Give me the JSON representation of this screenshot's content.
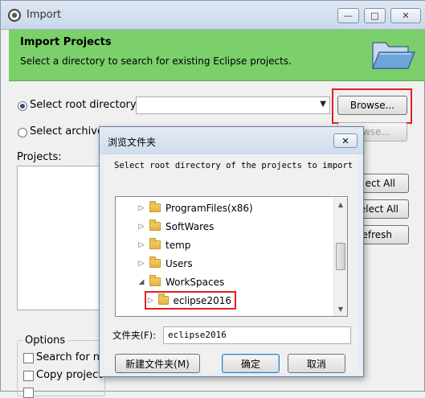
{
  "main_window": {
    "title": "Import",
    "caption_buttons": {
      "minimize": "—",
      "maximize": "□",
      "close": "✕"
    },
    "header": {
      "title": "Import Projects",
      "subtitle": "Select a directory to search for existing Eclipse projects.",
      "icon": "folder-open-icon"
    },
    "root_directory": {
      "label": "Select root directory:",
      "value": "",
      "browse_label": "Browse...",
      "selected": true
    },
    "archive_file": {
      "label": "Select archive",
      "browse_label": "Browse...",
      "selected": false
    },
    "projects_label": "Projects:",
    "side_buttons": {
      "select_all": "ect All",
      "deselect_all": "elect All",
      "refresh": "efresh"
    },
    "options": {
      "label": "Options",
      "search_nested": "Search for ne",
      "copy_projects": "Copy project"
    }
  },
  "dialog": {
    "title": "浏览文件夹",
    "close_label": "✕",
    "instruction": "Select root directory of the projects to import",
    "tree_items": [
      {
        "label": "ProgramFiles(x86)",
        "expander": "▷"
      },
      {
        "label": "SoftWares",
        "expander": "▷"
      },
      {
        "label": "temp",
        "expander": "▷"
      },
      {
        "label": "Users",
        "expander": "▷"
      },
      {
        "label": "WorkSpaces",
        "expander": "◢"
      },
      {
        "label": "eclipse2016",
        "expander": "▷",
        "selected": true
      }
    ],
    "folder_label": "文件夹(F):",
    "folder_value": "eclipse2016",
    "new_folder_label": "新建文件夹(M)",
    "ok_label": "确定",
    "cancel_label": "取消"
  },
  "colors": {
    "header_green": "#7bd06b",
    "highlight_red": "#e0211e"
  }
}
